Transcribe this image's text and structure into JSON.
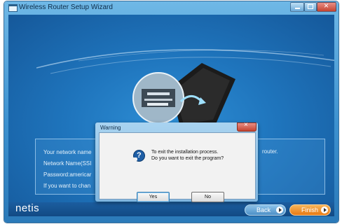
{
  "window": {
    "title": "Wireless Router Setup Wizard",
    "icon": "window-icon"
  },
  "info": {
    "line1": "Your network name",
    "line2": "Network Name(SSI",
    "line3": "Password:americar",
    "line4": "If you want to chan",
    "right_text": "router."
  },
  "footer": {
    "brand": "netis",
    "back_label": "Back",
    "finish_label": "Finish"
  },
  "dialog": {
    "title": "Warning",
    "message_line1": "To exit the installation process.",
    "message_line2": "Do you want to exit the program?",
    "yes_label": "Yes",
    "no_label": "No",
    "icon": "question-icon"
  },
  "colors": {
    "accent": "#1f75bd",
    "finish": "#e87a12",
    "back": "#4c8fc6"
  }
}
